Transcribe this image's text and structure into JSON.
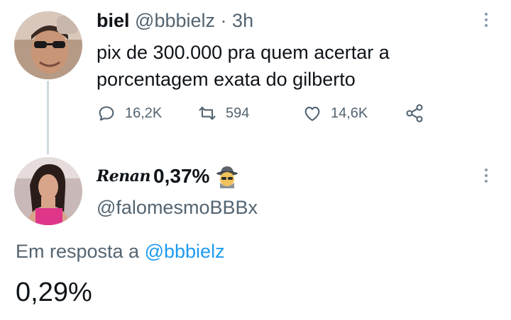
{
  "tweet": {
    "author_name": "biel",
    "author_handle": "@bbbielz",
    "separator": "·",
    "time": "3h",
    "text": "pix de 300.000 pra quem acertar a porcentagem exata do gilberto",
    "avatar_icon": "avatar-photo",
    "more_icon": "more-vertical-icon",
    "actions": {
      "replies": "16,2K",
      "retweets": "594",
      "likes": "14,6K",
      "reply_icon": "reply-icon",
      "retweet_icon": "retweet-icon",
      "like_icon": "heart-icon",
      "share_icon": "share-icon"
    }
  },
  "reply": {
    "author_name_styled": "Renan",
    "author_name_suffix": "0,37%",
    "author_emoji": "spy-emoji",
    "author_handle": "@falomesmoBBBx",
    "reply_to_prefix": "Em resposta a",
    "reply_to_mention": "@bbbielz",
    "text": "0,29%",
    "avatar_icon": "avatar-photo",
    "more_icon": "more-vertical-icon"
  },
  "colors": {
    "text_primary": "#0f1419",
    "text_secondary": "#536471",
    "link": "#1d9bf0",
    "thread_line": "#cfd9de"
  }
}
